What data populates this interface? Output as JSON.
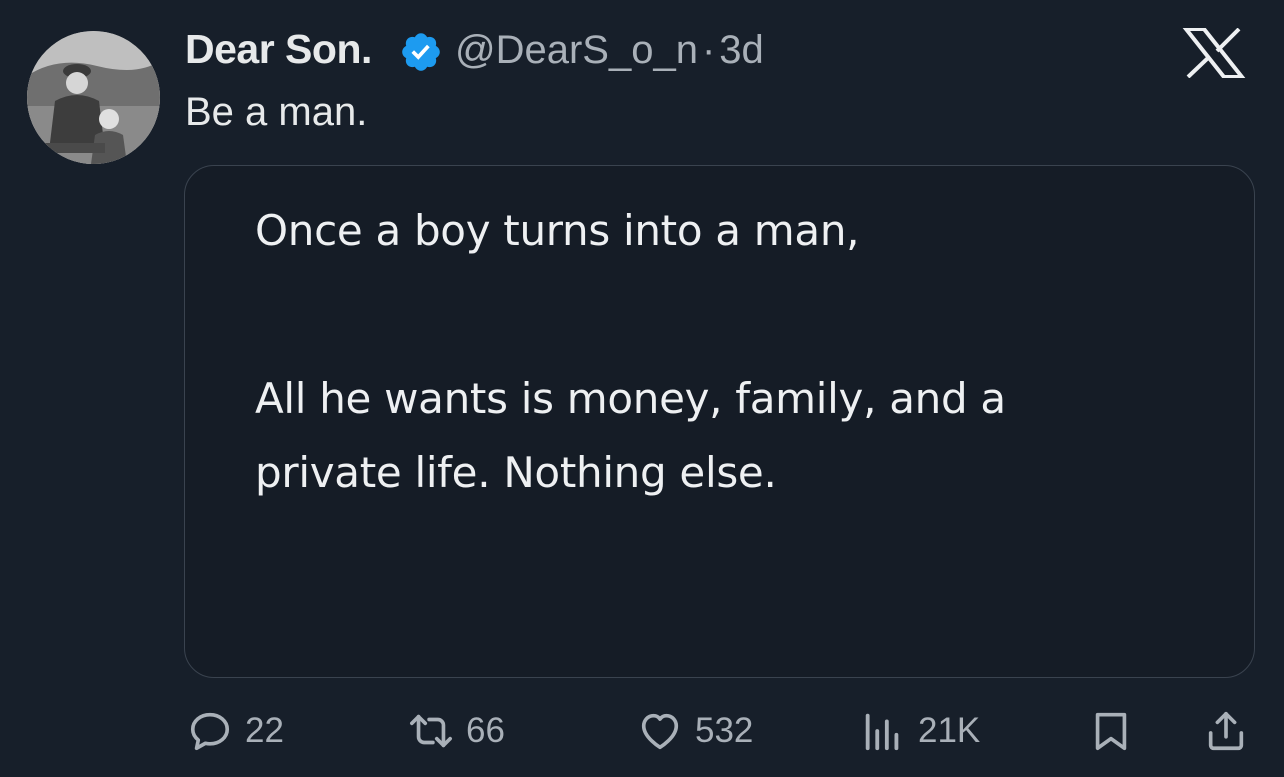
{
  "author": {
    "name": "Dear Son.",
    "handle": "@DearS_o_n",
    "separator": "·",
    "time": "3d",
    "verified_color": "#1d9bf0"
  },
  "tweet": {
    "text": "Be a man."
  },
  "media": {
    "line1": "Once a boy turns into a man,",
    "line2": "All he wants is money, family, and a",
    "line3": "private life. Nothing else."
  },
  "actions": {
    "reply_count": "22",
    "retweet_count": "66",
    "like_count": "532",
    "views_count": "21K"
  },
  "icons": {
    "reply": "reply-icon",
    "retweet": "retweet-icon",
    "like": "heart-icon",
    "views": "views-icon",
    "bookmark": "bookmark-icon",
    "share": "share-icon",
    "brand": "x-logo-icon",
    "verified": "verified-badge-icon"
  },
  "colors": {
    "background": "#171f2a",
    "text_primary": "#e7e9ea",
    "text_secondary": "#a9b0b8",
    "card_border": "#3a434f"
  }
}
